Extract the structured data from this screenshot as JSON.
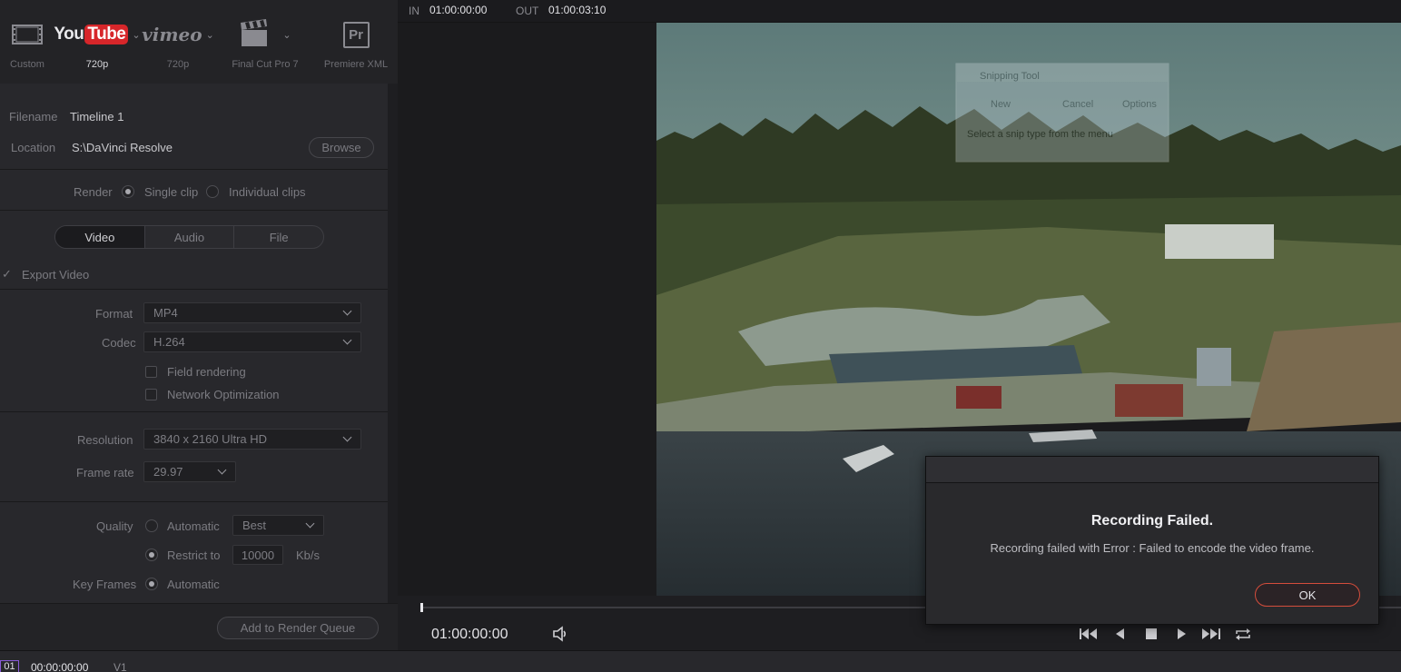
{
  "presets": [
    {
      "label": "Custom",
      "selected": false
    },
    {
      "label": "720p",
      "selected": true
    },
    {
      "label": "720p",
      "selected": false
    },
    {
      "label": "Final Cut Pro 7",
      "selected": false
    },
    {
      "label": "Premiere XML",
      "selected": false
    }
  ],
  "logos": {
    "youtube_you": "You",
    "youtube_tube": "Tube",
    "vimeo": "vimeo",
    "premiere": "Pr"
  },
  "file": {
    "filename_label": "Filename",
    "filename_value": "Timeline 1",
    "location_label": "Location",
    "location_value": "S:\\DaVinci Resolve",
    "browse_label": "Browse"
  },
  "render": {
    "label": "Render",
    "single_clip": "Single clip",
    "individual_clips": "Individual clips"
  },
  "tabs": [
    "Video",
    "Audio",
    "File"
  ],
  "export_video_label": "Export Video",
  "format": {
    "label": "Format",
    "value": "MP4"
  },
  "codec": {
    "label": "Codec",
    "value": "H.264"
  },
  "field_rendering": "Field rendering",
  "network_optimization": "Network Optimization",
  "resolution": {
    "label": "Resolution",
    "value": "3840 x 2160 Ultra HD"
  },
  "frame_rate": {
    "label": "Frame rate",
    "value": "29.97"
  },
  "quality": {
    "label": "Quality",
    "automatic": "Automatic",
    "best": "Best",
    "restrict_to": "Restrict to",
    "restrict_value": "10000",
    "unit": "Kb/s"
  },
  "key_frames": {
    "label": "Key Frames",
    "automatic": "Automatic"
  },
  "add_to_queue": "Add to Render Queue",
  "viewer": {
    "in_label": "IN",
    "in_tc": "01:00:00:00",
    "out_label": "OUT",
    "out_tc": "01:00:03:10",
    "current_tc": "01:00:00:00"
  },
  "overlay": {
    "title": "Snipping Tool",
    "new": "New",
    "cancel": "Cancel",
    "options": "Options",
    "hint": "Select a snip type from the menu"
  },
  "dialog": {
    "title": "Recording Failed.",
    "message": "Recording failed with Error : Failed to encode the video frame.",
    "ok": "OK"
  },
  "timeline": {
    "track_num": "01",
    "tc": "00:00:00:00",
    "track": "V1"
  },
  "colors": {
    "accent_red": "#d44d3c",
    "youtube_red": "#d7262a"
  }
}
